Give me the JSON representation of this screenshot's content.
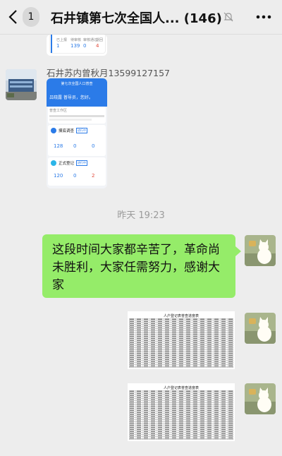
{
  "header": {
    "badge_count": "1",
    "title": "石井镇第七次全国人...",
    "member_count": "(146)"
  },
  "top_card": {
    "numbers": [
      "1",
      "139",
      "0",
      "4"
    ]
  },
  "message1": {
    "sender": "石井苏内曾秋月13599127157",
    "screenshot": {
      "app_title": "第七次全国人口普查",
      "greeting": "吕晓露 普导员，您好。",
      "section_label": "普查工作区",
      "cards": [
        {
          "label": "摸底调查",
          "tag": "进行中",
          "numbers": [
            "128",
            "0",
            "0"
          ]
        },
        {
          "label": "正式登记",
          "tag": "进行中",
          "numbers": [
            "120",
            "0",
            "2"
          ]
        }
      ]
    }
  },
  "timestamp": "昨天 19:23",
  "message2": {
    "text": "这段时间大家都辛苦了，革命尚未胜利，大家任需努力，感谢大家"
  },
  "sheets": [
    {
      "title": "人户登记表普查进度表"
    },
    {
      "title": "人户登记表普查进度表"
    }
  ],
  "colors": {
    "background": "#ededed",
    "bubble": "#95ec69",
    "accent": "#2b7be8"
  }
}
